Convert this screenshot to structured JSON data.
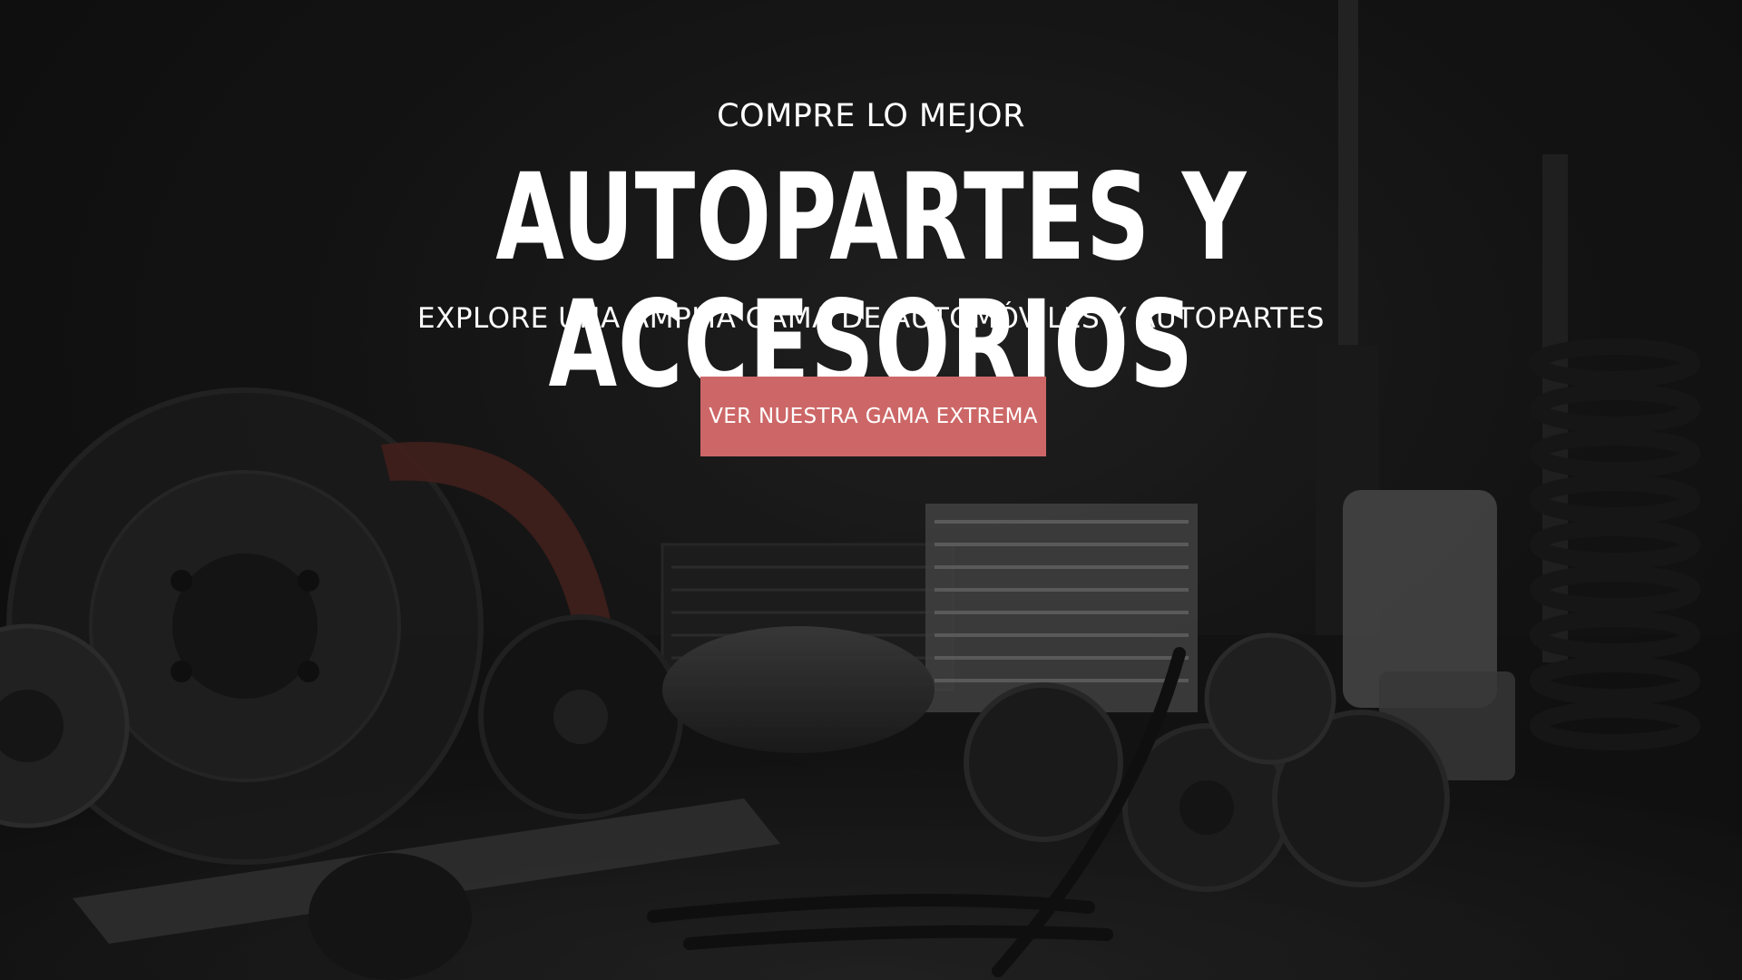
{
  "hero": {
    "kicker": "COMPRE LO MEJOR",
    "headline": "AUTOPARTES Y ACCESORIOS",
    "subtitle": "EXPLORE UNA AMPLIA GAMA DE AUTOMÓVILES Y AUTOPARTES",
    "cta_label": "VER NUESTRA GAMA EXTREMA",
    "background_image": "auto-parts-assortment-photo"
  },
  "colors": {
    "background": "#141414",
    "text": "#ffffff",
    "cta_background": "#cd6767"
  }
}
